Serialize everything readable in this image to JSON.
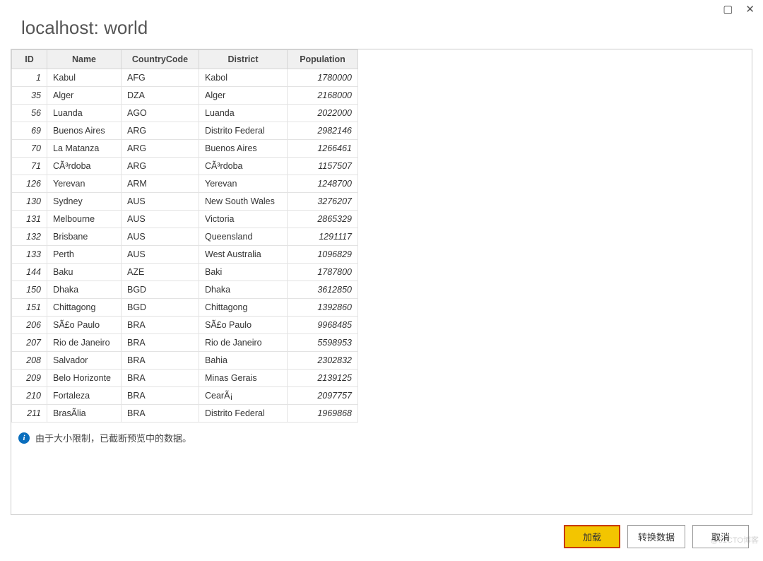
{
  "window": {
    "title": "localhost: world",
    "maximize_glyph": "▢",
    "close_glyph": "✕"
  },
  "table": {
    "columns": [
      "ID",
      "Name",
      "CountryCode",
      "District",
      "Population"
    ],
    "rows": [
      {
        "id": 1,
        "name": "Kabul",
        "cc": "AFG",
        "dist": "Kabol",
        "pop": 1780000
      },
      {
        "id": 35,
        "name": "Alger",
        "cc": "DZA",
        "dist": "Alger",
        "pop": 2168000
      },
      {
        "id": 56,
        "name": "Luanda",
        "cc": "AGO",
        "dist": "Luanda",
        "pop": 2022000
      },
      {
        "id": 69,
        "name": "Buenos Aires",
        "cc": "ARG",
        "dist": "Distrito Federal",
        "pop": 2982146
      },
      {
        "id": 70,
        "name": "La Matanza",
        "cc": "ARG",
        "dist": "Buenos Aires",
        "pop": 1266461
      },
      {
        "id": 71,
        "name": "CÃ³rdoba",
        "cc": "ARG",
        "dist": "CÃ³rdoba",
        "pop": 1157507
      },
      {
        "id": 126,
        "name": "Yerevan",
        "cc": "ARM",
        "dist": "Yerevan",
        "pop": 1248700
      },
      {
        "id": 130,
        "name": "Sydney",
        "cc": "AUS",
        "dist": "New South Wales",
        "pop": 3276207
      },
      {
        "id": 131,
        "name": "Melbourne",
        "cc": "AUS",
        "dist": "Victoria",
        "pop": 2865329
      },
      {
        "id": 132,
        "name": "Brisbane",
        "cc": "AUS",
        "dist": "Queensland",
        "pop": 1291117
      },
      {
        "id": 133,
        "name": "Perth",
        "cc": "AUS",
        "dist": "West Australia",
        "pop": 1096829
      },
      {
        "id": 144,
        "name": "Baku",
        "cc": "AZE",
        "dist": "Baki",
        "pop": 1787800
      },
      {
        "id": 150,
        "name": "Dhaka",
        "cc": "BGD",
        "dist": "Dhaka",
        "pop": 3612850
      },
      {
        "id": 151,
        "name": "Chittagong",
        "cc": "BGD",
        "dist": "Chittagong",
        "pop": 1392860
      },
      {
        "id": 206,
        "name": "SÃ£o Paulo",
        "cc": "BRA",
        "dist": "SÃ£o Paulo",
        "pop": 9968485
      },
      {
        "id": 207,
        "name": "Rio de Janeiro",
        "cc": "BRA",
        "dist": "Rio de Janeiro",
        "pop": 5598953
      },
      {
        "id": 208,
        "name": "Salvador",
        "cc": "BRA",
        "dist": "Bahia",
        "pop": 2302832
      },
      {
        "id": 209,
        "name": "Belo Horizonte",
        "cc": "BRA",
        "dist": "Minas Gerais",
        "pop": 2139125
      },
      {
        "id": 210,
        "name": "Fortaleza",
        "cc": "BRA",
        "dist": "CearÃ¡",
        "pop": 2097757
      },
      {
        "id": 211,
        "name": "BrasÃ­lia",
        "cc": "BRA",
        "dist": "Distrito Federal",
        "pop": 1969868
      }
    ]
  },
  "notice": {
    "icon_glyph": "i",
    "text": "由于大小限制，已截断预览中的数据。"
  },
  "buttons": {
    "load": "加载",
    "transform": "转换数据",
    "cancel": "取消"
  },
  "watermark": "@51CTO博客"
}
